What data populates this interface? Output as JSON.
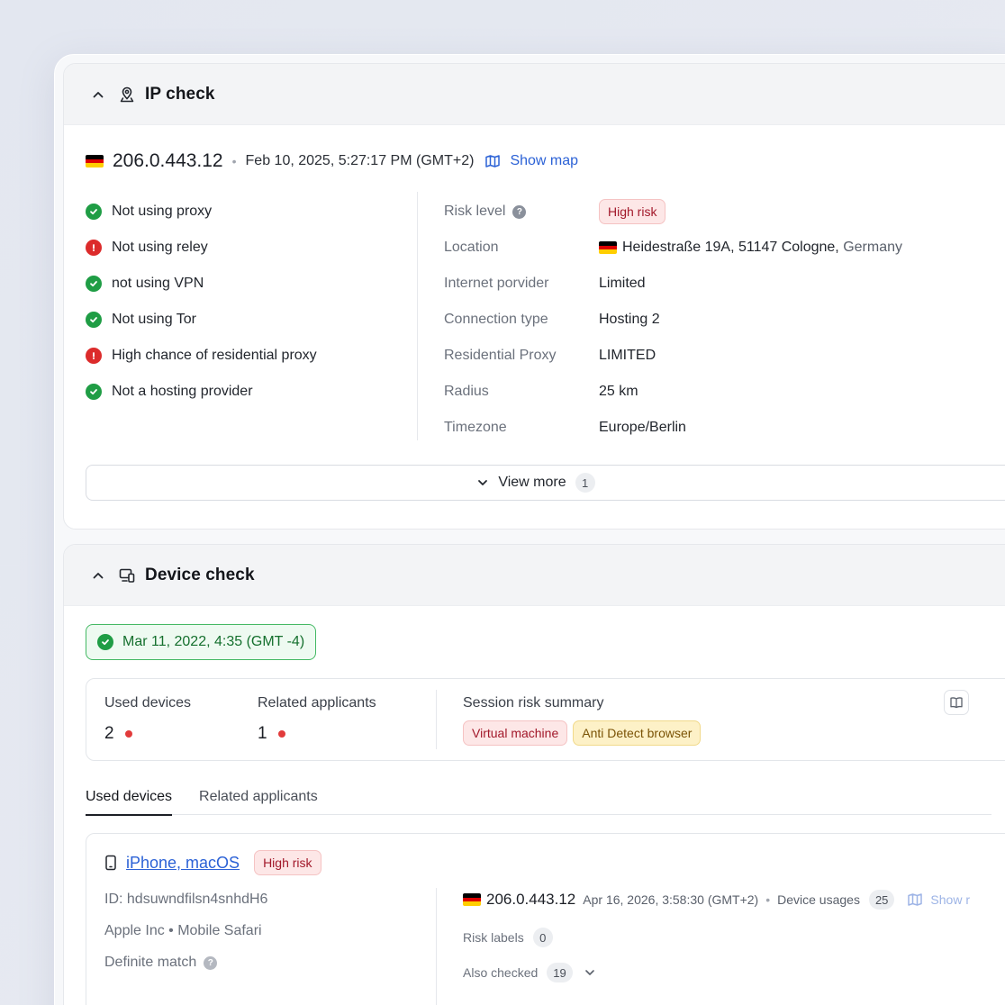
{
  "ip_check": {
    "title": "IP check",
    "ip": "206.0.443.12",
    "timestamp": "Feb 10, 2025, 5:27:17 PM (GMT+2)",
    "show_map": "Show map",
    "checks": [
      {
        "label": "Not using proxy",
        "status": "ok"
      },
      {
        "label": "Not using reley",
        "status": "warn"
      },
      {
        "label": "not using VPN",
        "status": "ok"
      },
      {
        "label": "Not using Tor",
        "status": "ok"
      },
      {
        "label": "High chance of residential proxy",
        "status": "warn"
      },
      {
        "label": "Not a hosting provider",
        "status": "ok"
      }
    ],
    "props": {
      "risk_level_key": "Risk level",
      "risk_level_val": "High risk",
      "location_key": "Location",
      "location_street": "Heidestraße 19A, 51147 Cologne,",
      "location_country": " Germany",
      "provider_key": "Internet porvider",
      "provider_val": "Limited",
      "connection_key": "Connection type",
      "connection_val": "Hosting 2",
      "residential_key": "Residential Proxy",
      "residential_val": "LIMITED",
      "radius_key": "Radius",
      "radius_val": "25 km",
      "timezone_key": "Timezone",
      "timezone_val": "Europe/Berlin"
    },
    "view_more": "View more",
    "view_more_count": "1"
  },
  "device_check": {
    "title": "Device check",
    "date_badge": "Mar 11, 2022, 4:35 (GMT -4)",
    "used_devices_label": "Used devices",
    "used_devices_value": "2",
    "related_label": "Related applicants",
    "related_value": "1",
    "session_label": "Session risk summary",
    "session_tags": [
      "Virtual machine",
      "Anti Detect browser"
    ],
    "tabs": [
      "Used devices",
      "Related applicants"
    ],
    "device": {
      "name": "iPhone, macOS",
      "risk": "High risk",
      "id": "ID: hdsuwndfilsn4snhdH6",
      "vendor": "Apple Inc • Mobile Safari",
      "match": "Definite match",
      "ip": "206.0.443.12",
      "ip_time": "Apr 16, 2026, 3:58:30 (GMT+2)",
      "usages_label": "Device usages",
      "usages_count": "25",
      "show_label": "Show r",
      "risk_labels": "Risk labels",
      "risk_labels_count": "0",
      "also_checked": "Also checked",
      "also_checked_count": "19"
    }
  },
  "colors": {
    "ok": "#1f9d45",
    "warn": "#dc2b2b",
    "link": "#2c62d6"
  }
}
